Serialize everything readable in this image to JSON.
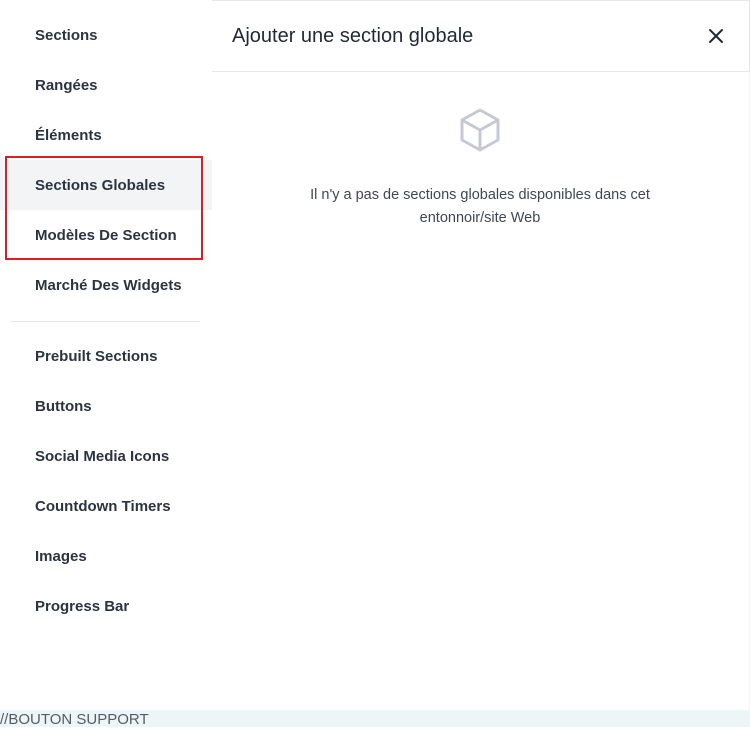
{
  "sidebar": {
    "items": [
      {
        "label": "Sections"
      },
      {
        "label": "Rangées"
      },
      {
        "label": "Éléments"
      },
      {
        "label": "Sections Globales",
        "active": true
      },
      {
        "label": "Modèles De Section"
      },
      {
        "label": "Marché Des Widgets"
      },
      {
        "label": "Prebuilt Sections"
      },
      {
        "label": "Buttons"
      },
      {
        "label": "Social Media Icons"
      },
      {
        "label": "Countdown Timers"
      },
      {
        "label": "Images"
      },
      {
        "label": "Progress Bar"
      }
    ]
  },
  "main": {
    "title": "Ajouter une section globale",
    "close_icon": "close-icon",
    "empty_state": {
      "icon": "cube-icon",
      "line1": "Il n'y a pas de sections globales disponibles dans cet",
      "line2": "entonnoir/site Web"
    }
  },
  "bottom_bar": {
    "text": "//BOUTON SUPPORT"
  },
  "colors": {
    "highlight": "#e11d24",
    "active_bg": "#f3f4f6",
    "bottom_bar_bg": "#edf6f7"
  }
}
